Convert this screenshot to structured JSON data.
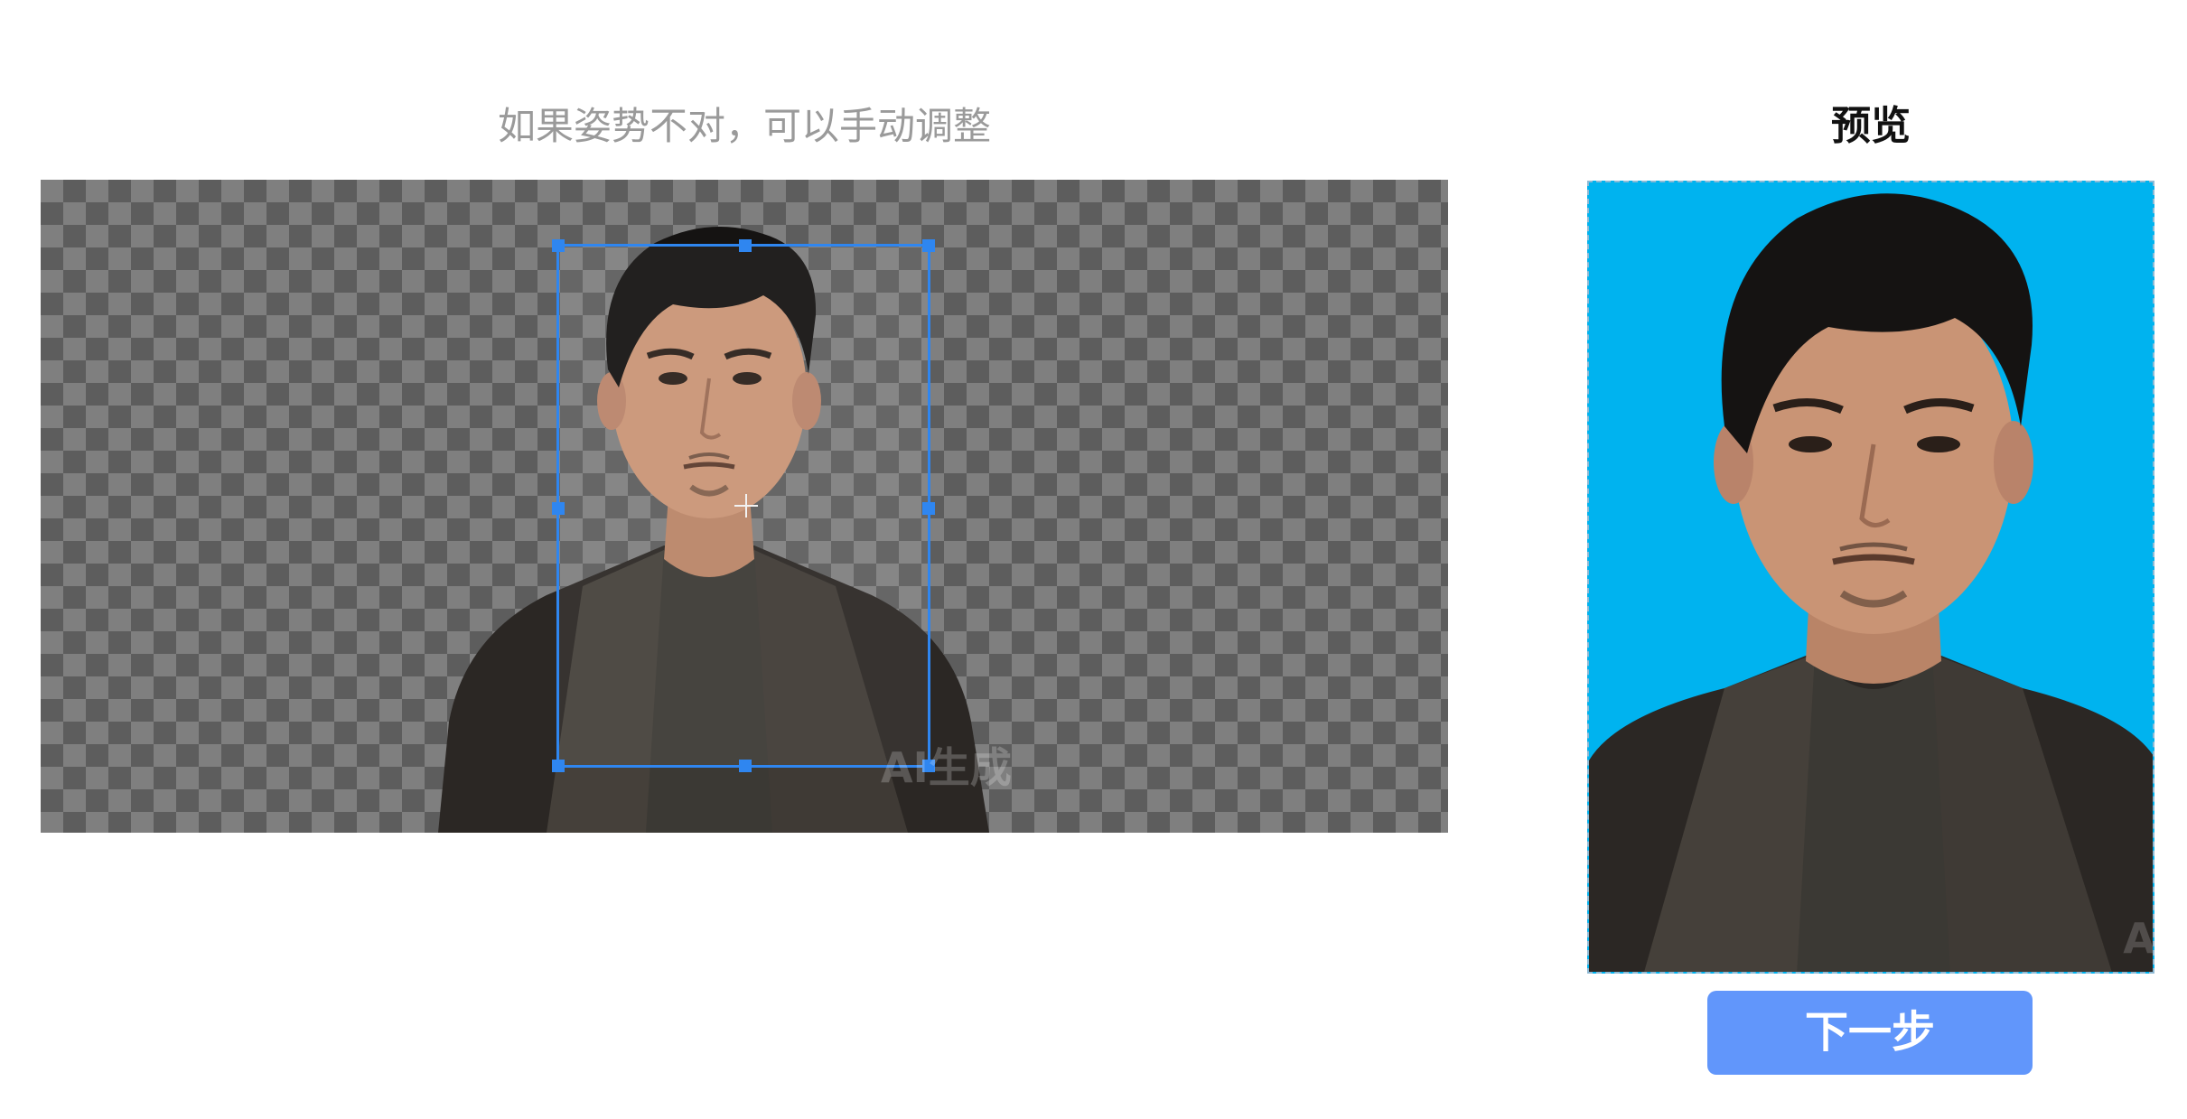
{
  "editor": {
    "hint": "如果姿势不对，可以手动调整",
    "watermark": "AI生成"
  },
  "preview": {
    "title": "预览",
    "background_color": "#00b3ef",
    "watermark": "AI"
  },
  "actions": {
    "next_label": "下一步"
  },
  "colors": {
    "accent": "#2f86f0",
    "button": "#6196fb"
  },
  "icons": {
    "crop_center": "crosshair-icon"
  }
}
